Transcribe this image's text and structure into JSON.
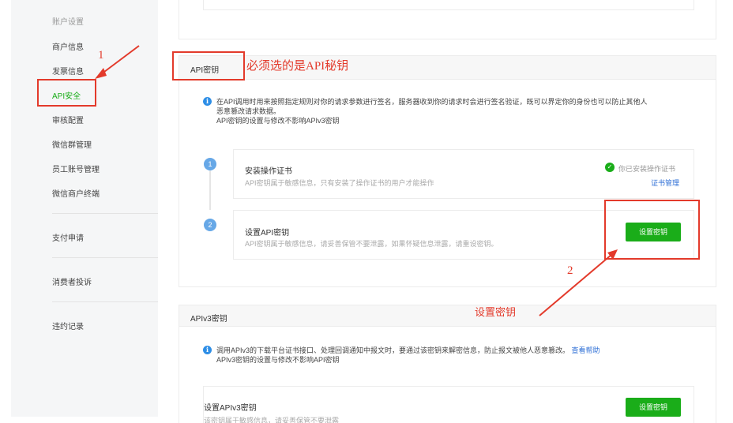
{
  "sidebar": {
    "section_title": "账户设置",
    "items": [
      {
        "label": "商户信息"
      },
      {
        "label": "发票信息"
      },
      {
        "label": "API安全"
      },
      {
        "label": "审核配置"
      },
      {
        "label": "微信群管理"
      },
      {
        "label": "员工账号管理"
      },
      {
        "label": "微信商户终端"
      }
    ],
    "bottom_items": [
      {
        "label": "支付申请"
      },
      {
        "label": "消费者投诉"
      },
      {
        "label": "违约记录"
      }
    ]
  },
  "api_key_panel": {
    "title": "API密钥",
    "info_lines": [
      "在API调用时用来按照指定规则对你的请求参数进行签名，服务器收到你的请求时会进行签名验证，既可以界定你的身份也可以防止其他人",
      "恶意篡改请求数据。",
      "API密钥的设置与修改不影响APIv3密钥"
    ],
    "steps": [
      {
        "number": "1",
        "title": "安装操作证书",
        "desc": "API密钥属于敏感信息，只有安装了操作证书的用户才能操作",
        "status": "你已安装操作证书",
        "link": "证书管理"
      },
      {
        "number": "2",
        "title": "设置API密钥",
        "desc": "API密钥属于敏感信息，请妥善保管不要泄露，如果怀疑信息泄露，请重设密钥。",
        "button": "设置密钥"
      }
    ]
  },
  "apiv3_panel": {
    "title": "APIv3密钥",
    "info_line1": "调用APIv3的下载平台证书接口、处理回调通知中报文时，要通过该密钥来解密信息，防止报文被他人恶意篡改。",
    "info_link": "查看帮助",
    "info_line2": "APIv3密钥的设置与修改不影响API密钥",
    "card_title": "设置APIv3密钥",
    "card_desc": "该密钥属于敏感信息，请妥善保管不要泄露",
    "button": "设置密钥"
  },
  "annotations": {
    "label_1": "1",
    "label_2": "2",
    "note_api": "必须选的是API秘钥",
    "note_set_key": "设置密钥"
  },
  "colors": {
    "accent_green": "#1aad19",
    "annotation_red": "#e33a2b",
    "info_blue": "#2e8ee6",
    "link_blue": "#2e6fd6"
  }
}
